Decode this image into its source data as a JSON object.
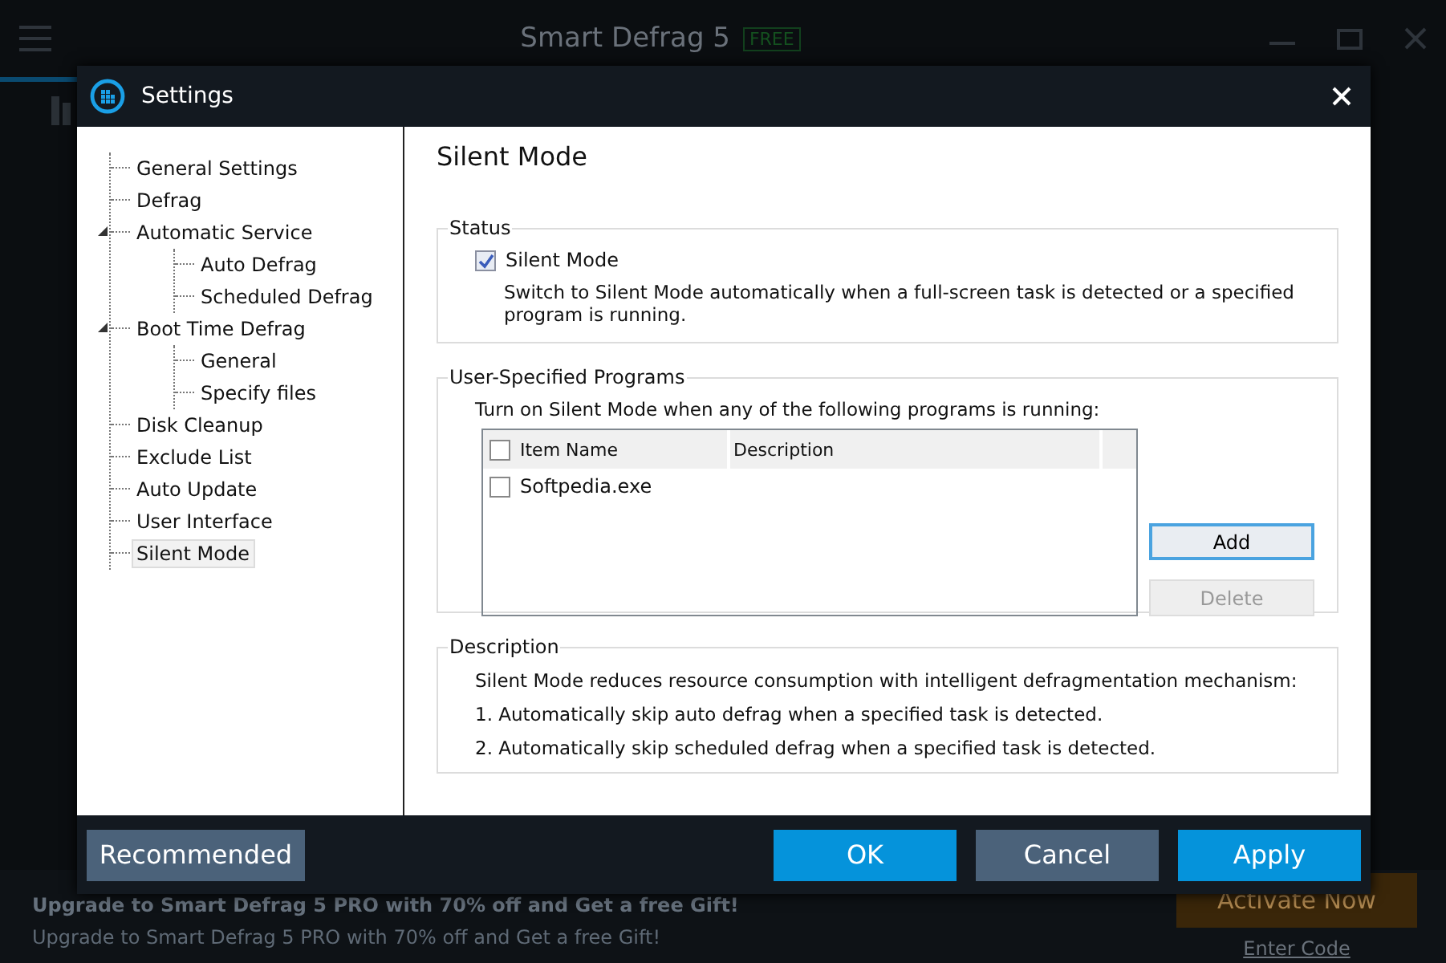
{
  "app": {
    "title": "Smart Defrag 5",
    "edition": "FREE",
    "promo_headline": "Upgrade to Smart Defrag 5 PRO with 70% off and Get a free Gift!",
    "promo_text": "Upgrade to Smart Defrag 5 PRO with 70% off and Get a free Gift!",
    "activate_button": "Activate Now",
    "enter_code_link": "Enter Code"
  },
  "dialog": {
    "title": "Settings",
    "nav": [
      {
        "label": "General Settings",
        "selected": false
      },
      {
        "label": "Defrag",
        "selected": false
      },
      {
        "label": "Automatic Service",
        "selected": false,
        "expanded": true,
        "children": [
          {
            "label": "Auto Defrag",
            "selected": false
          },
          {
            "label": "Scheduled Defrag",
            "selected": false
          }
        ]
      },
      {
        "label": "Boot Time Defrag",
        "selected": false,
        "expanded": true,
        "children": [
          {
            "label": "General",
            "selected": false
          },
          {
            "label": "Specify files",
            "selected": false
          }
        ]
      },
      {
        "label": "Disk Cleanup",
        "selected": false
      },
      {
        "label": "Exclude List",
        "selected": false
      },
      {
        "label": "Auto Update",
        "selected": false
      },
      {
        "label": "User Interface",
        "selected": false
      },
      {
        "label": "Silent Mode",
        "selected": true
      }
    ],
    "page_title": "Silent Mode",
    "status": {
      "heading": "Status",
      "checkbox": {
        "label": "Silent Mode",
        "checked": true
      },
      "note": "Switch to Silent Mode automatically when a full-screen task is detected or a specified program is running."
    },
    "programs": {
      "heading": "User-Specified Programs",
      "intro": "Turn on Silent Mode when any of the following programs is running:",
      "table": {
        "select_all_checked": false,
        "columns": [
          "Item Name",
          "Description"
        ],
        "rows": [
          {
            "name": "Softpedia.exe",
            "checked": false
          }
        ]
      },
      "buttons": [
        {
          "label": "Add",
          "disabled": false
        },
        {
          "label": "Delete",
          "disabled": true
        }
      ]
    },
    "description": {
      "heading": "Description",
      "lines": [
        "Silent Mode reduces resource consumption with intelligent defragmentation mechanism:",
        "1. Automatically skip auto defrag when a specified task is detected.",
        "2. Automatically skip scheduled defrag when a specified task is detected."
      ]
    },
    "footer": {
      "recommended": "Recommended",
      "buttons": [
        {
          "label": "OK",
          "kind": "primary"
        },
        {
          "label": "Cancel",
          "kind": "secondary"
        },
        {
          "label": "Apply",
          "kind": "primary"
        }
      ]
    }
  }
}
